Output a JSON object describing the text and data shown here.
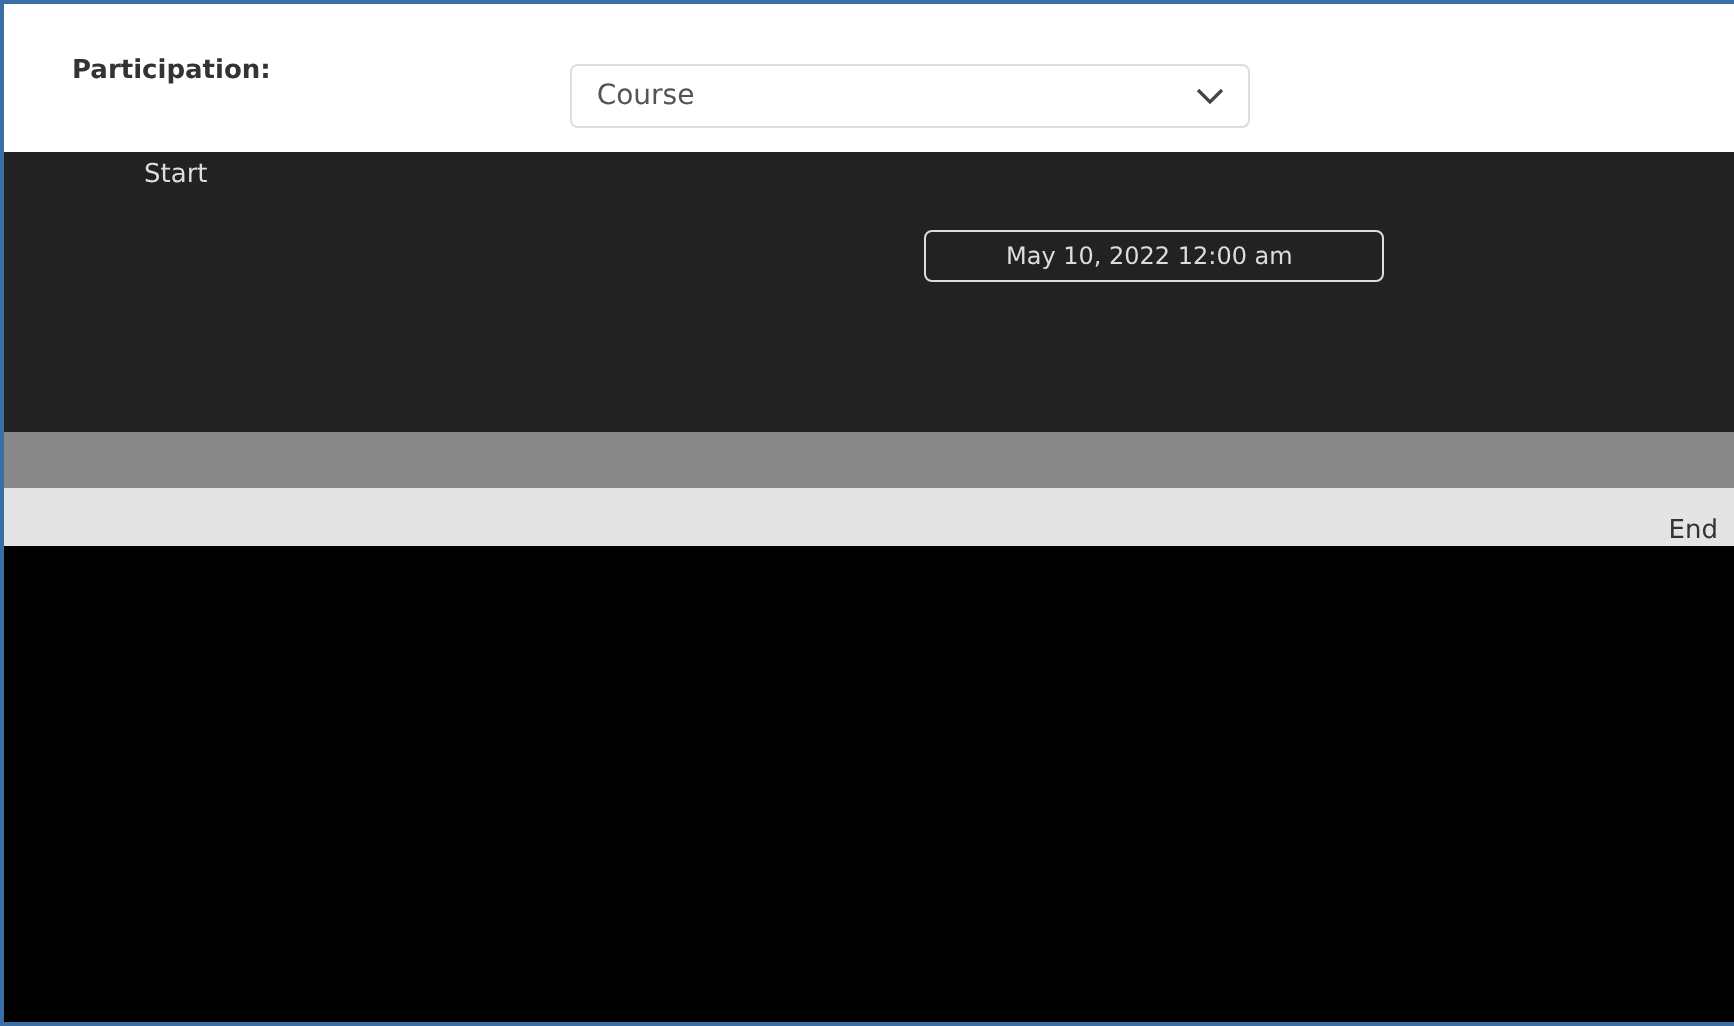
{
  "participation": {
    "label": "Participation:",
    "dropdown": {
      "value": "Course"
    }
  },
  "start": {
    "label": "Start",
    "date_field": {
      "value": "May 10, 2022 12:00 am"
    }
  },
  "end": {
    "label": "End"
  }
}
